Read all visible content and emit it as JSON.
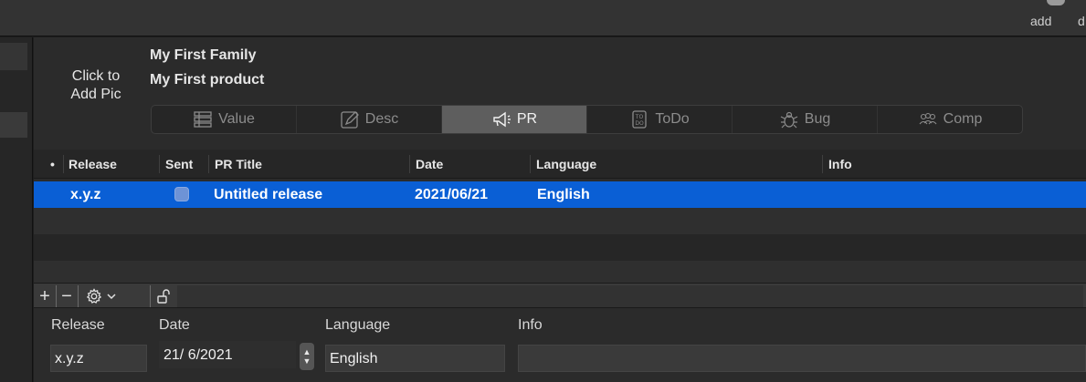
{
  "topbar": {
    "add_label": "add",
    "trailing_label": "d"
  },
  "header": {
    "pic_label_line1": "Click to",
    "pic_label_line2": "Add Pic",
    "family": "My First Family",
    "product": "My First product"
  },
  "tabs": [
    {
      "label": "Value",
      "icon": "value-icon",
      "active": false
    },
    {
      "label": "Desc",
      "icon": "desc-icon",
      "active": false
    },
    {
      "label": "PR",
      "icon": "megaphone-icon",
      "active": true
    },
    {
      "label": "ToDo",
      "icon": "todo-icon",
      "active": false
    },
    {
      "label": "Bug",
      "icon": "bug-icon",
      "active": false
    },
    {
      "label": "Comp",
      "icon": "people-icon",
      "active": false
    }
  ],
  "table": {
    "columns": {
      "dot": "•",
      "release": "Release",
      "sent": "Sent",
      "pr_title": "PR Title",
      "date": "Date",
      "language": "Language",
      "info": "Info"
    },
    "rows": [
      {
        "release": "x.y.z",
        "sent": false,
        "pr_title": "Untitled release",
        "date": "2021/06/21",
        "language": "English",
        "info": ""
      }
    ]
  },
  "toolbar": {
    "add": "+",
    "remove": "−",
    "gear_icon": "gear-icon",
    "chevron_icon": "chevron-down-icon",
    "lock_icon": "unlock-icon"
  },
  "form": {
    "release_label": "Release",
    "date_label": "Date",
    "language_label": "Language",
    "info_label": "Info",
    "release_value": "x.y.z",
    "date_value": "21/ 6/2021",
    "language_value": "English",
    "info_value": ""
  },
  "colors": {
    "selection": "#0a5fd5",
    "active_tab": "#5e5e5e",
    "background": "#2b2b2b"
  }
}
